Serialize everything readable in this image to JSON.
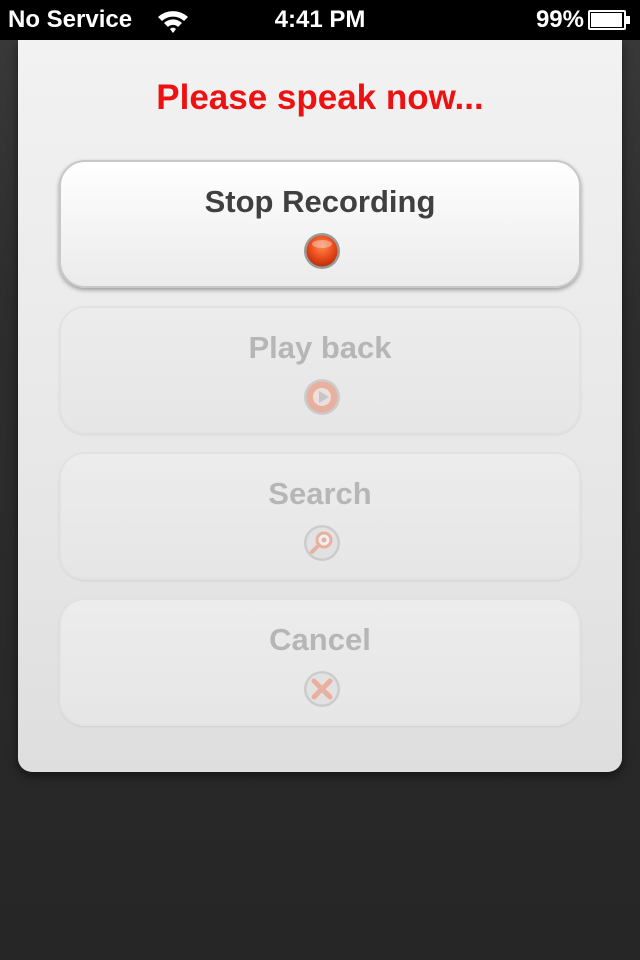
{
  "status_bar": {
    "carrier": "No Service",
    "time": "4:41 PM",
    "battery_percent": "99%",
    "icons": [
      "wifi-icon",
      "battery-icon"
    ]
  },
  "dialog": {
    "prompt": "Please speak now...",
    "buttons": [
      {
        "label": "Stop Recording",
        "icon": "record-icon",
        "enabled": true
      },
      {
        "label": "Play back",
        "icon": "play-icon",
        "enabled": false
      },
      {
        "label": "Search",
        "icon": "search-icon",
        "enabled": false
      },
      {
        "label": "Cancel",
        "icon": "cancel-icon",
        "enabled": false
      }
    ]
  },
  "colors": {
    "prompt": "#ee1111",
    "accent_red": "#e84a1a",
    "label_active": "#404040",
    "label_disabled": "#b6b6b6",
    "backdrop": "#2d2d2d"
  }
}
